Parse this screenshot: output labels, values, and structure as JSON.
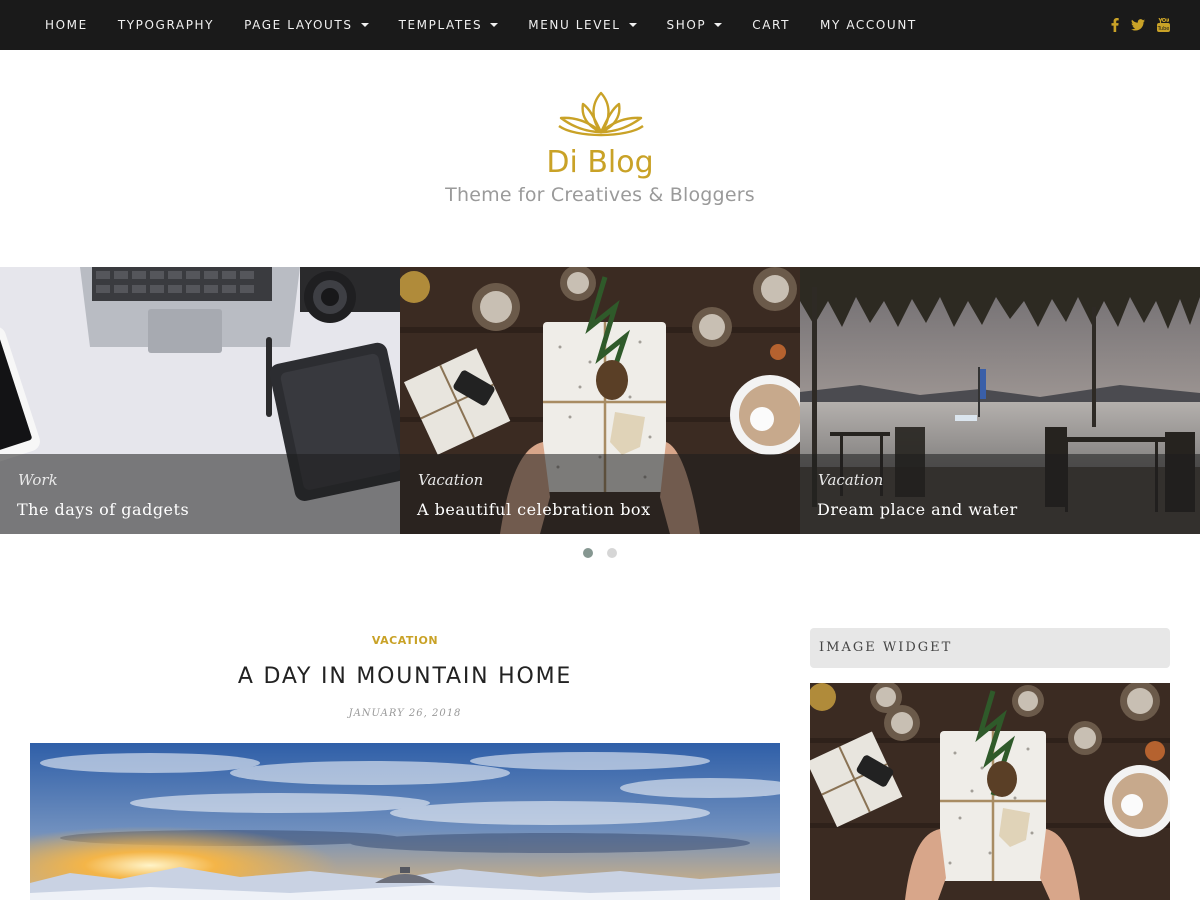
{
  "nav": {
    "items": [
      {
        "label": "HOME",
        "dropdown": false
      },
      {
        "label": "TYPOGRAPHY",
        "dropdown": false
      },
      {
        "label": "PAGE LAYOUTS",
        "dropdown": true
      },
      {
        "label": "TEMPLATES",
        "dropdown": true
      },
      {
        "label": "MENU LEVEL",
        "dropdown": true
      },
      {
        "label": "SHOP",
        "dropdown": true
      },
      {
        "label": "CART",
        "dropdown": false
      },
      {
        "label": "MY ACCOUNT",
        "dropdown": false
      }
    ],
    "social_icons": [
      "facebook-icon",
      "twitter-icon",
      "youtube-icon"
    ]
  },
  "header": {
    "logo_icon": "lotus-icon",
    "site_title": "Di Blog",
    "tagline": "Theme for Creatives & Bloggers"
  },
  "slider": {
    "slides": [
      {
        "category": "Work",
        "title": "The days of gadgets"
      },
      {
        "category": "Vacation",
        "title": "A beautiful celebration box"
      },
      {
        "category": "Vacation",
        "title": "Dream place and water"
      }
    ],
    "dots": 2,
    "active_dot": 0
  },
  "post": {
    "category": "VACATION",
    "title": "A DAY IN MOUNTAIN HOME",
    "date": "JANUARY 26, 2018"
  },
  "sidebar": {
    "widget_title": "IMAGE WIDGET"
  },
  "colors": {
    "accent": "#c9a227",
    "topbar": "#1a1a1a",
    "widget_bg": "#e7e7e7"
  }
}
